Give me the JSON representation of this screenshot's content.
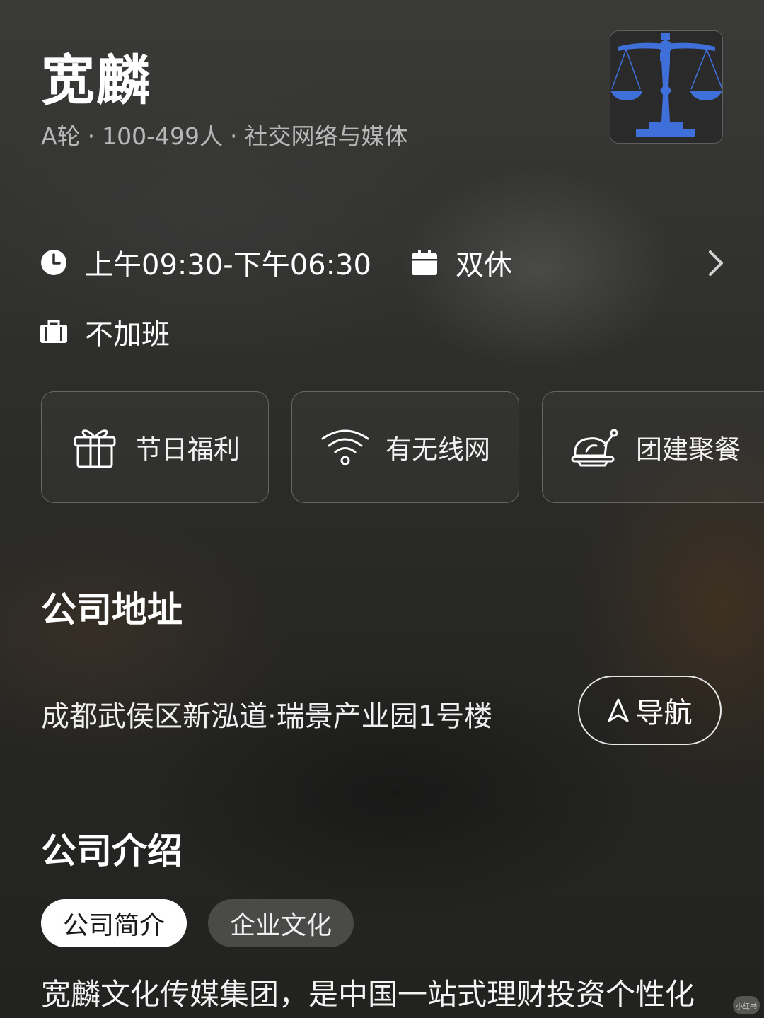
{
  "company": {
    "name": "宽麟",
    "funding": "A轮",
    "size": "100-499人",
    "industry": "社交网络与媒体",
    "separator": "·",
    "logo_icon": "balance-scale-icon",
    "logo_color": "#3f6fd8"
  },
  "work_info": {
    "hours": "上午09:30-下午06:30",
    "hours_icon": "clock-icon",
    "rest": "双休",
    "rest_icon": "calendar-icon",
    "overtime": "不加班",
    "overtime_icon": "briefcase-icon",
    "more_icon": "chevron-right-icon"
  },
  "perks": [
    {
      "label": "节日福利",
      "icon": "gift-icon"
    },
    {
      "label": "有无线网",
      "icon": "wifi-icon"
    },
    {
      "label": "团建聚餐",
      "icon": "roast-chicken-icon"
    }
  ],
  "address_section": {
    "title": "公司地址",
    "address": "成都武侯区新泓道·瑞景产业园1号楼",
    "nav_label": "导航",
    "nav_icon": "navigation-arrow-icon"
  },
  "intro_section": {
    "title": "公司介绍",
    "tabs": [
      {
        "label": "公司简介",
        "active": true
      },
      {
        "label": "企业文化",
        "active": false
      }
    ],
    "text": "宽麟文化传媒集团，是中国一站式理财投资个性化"
  },
  "watermark": "小红书"
}
